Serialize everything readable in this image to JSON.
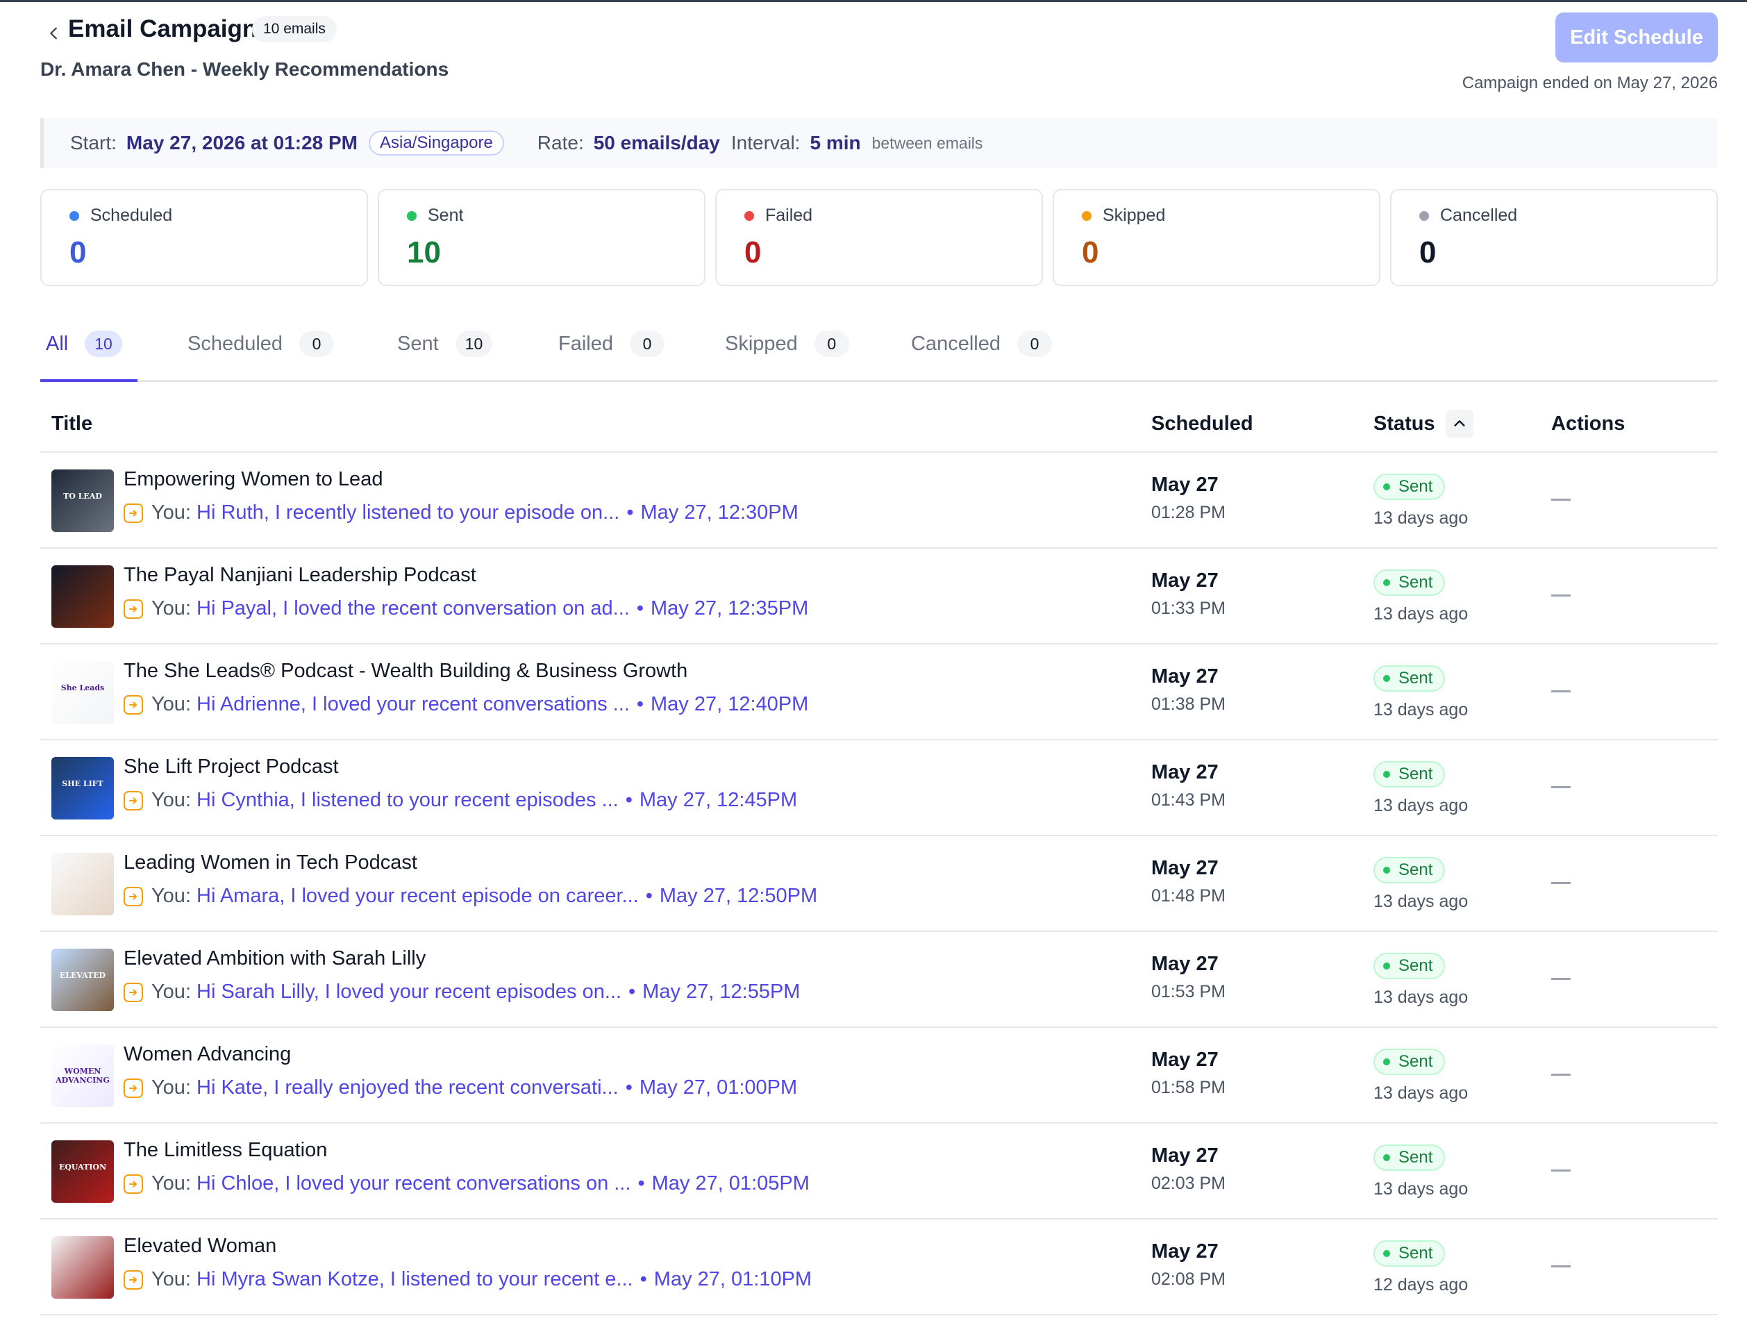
{
  "header": {
    "title": "Email Campaign",
    "count_badge": "10 emails",
    "subtitle": "Dr. Amara Chen - Weekly Recommendations",
    "edit_button": "Edit Schedule",
    "ended_text": "Campaign ended on May 27, 2026"
  },
  "schedule": {
    "start_label": "Start:",
    "start_value": "May 27, 2026 at 01:28 PM",
    "timezone": "Asia/Singapore",
    "rate_label": "Rate:",
    "rate_value": "50 emails/day",
    "interval_label": "Interval:",
    "interval_value": "5 min",
    "interval_suffix": "between emails"
  },
  "stats": [
    {
      "label": "Scheduled",
      "value": "0",
      "color": "#3b5bdb",
      "dot": "#3b82f6"
    },
    {
      "label": "Sent",
      "value": "10",
      "color": "#15803d",
      "dot": "#22c55e"
    },
    {
      "label": "Failed",
      "value": "0",
      "color": "#b91c1c",
      "dot": "#ef4444"
    },
    {
      "label": "Skipped",
      "value": "0",
      "color": "#b45309",
      "dot": "#f59e0b"
    },
    {
      "label": "Cancelled",
      "value": "0",
      "color": "#111827",
      "dot": "#9ca3af"
    }
  ],
  "tabs": [
    {
      "label": "All",
      "count": "10"
    },
    {
      "label": "Scheduled",
      "count": "0"
    },
    {
      "label": "Sent",
      "count": "10"
    },
    {
      "label": "Failed",
      "count": "0"
    },
    {
      "label": "Skipped",
      "count": "0"
    },
    {
      "label": "Cancelled",
      "count": "0"
    }
  ],
  "table": {
    "headers": {
      "title": "Title",
      "scheduled": "Scheduled",
      "status": "Status",
      "actions": "Actions"
    },
    "rows": [
      {
        "title": "Empowering Women to Lead",
        "you": "You:",
        "preview": "Hi Ruth, I recently listened to your episode on...",
        "sep": "•",
        "msg_time": "May 27, 12:30PM",
        "date": "May 27",
        "time": "01:28 PM",
        "status": "Sent",
        "ago": "13 days ago",
        "thumb_colors": [
          "#1f2937",
          "#6b7280"
        ],
        "thumb_text": "TO LEAD"
      },
      {
        "title": "The Payal Nanjiani Leadership Podcast",
        "you": "You:",
        "preview": "Hi Payal, I loved the recent conversation on ad...",
        "sep": "•",
        "msg_time": "May 27, 12:35PM",
        "date": "May 27",
        "time": "01:33 PM",
        "status": "Sent",
        "ago": "13 days ago",
        "thumb_colors": [
          "#111827",
          "#7c2d12"
        ],
        "thumb_text": ""
      },
      {
        "title": "The She Leads® Podcast - Wealth Building & Business Growth",
        "you": "You:",
        "preview": "Hi Adrienne, I loved your recent conversations ...",
        "sep": "•",
        "msg_time": "May 27, 12:40PM",
        "date": "May 27",
        "time": "01:38 PM",
        "status": "Sent",
        "ago": "13 days ago",
        "thumb_colors": [
          "#ffffff",
          "#f3f4f6"
        ],
        "thumb_text": "She Leads"
      },
      {
        "title": "She Lift Project Podcast",
        "you": "You:",
        "preview": "Hi Cynthia, I listened to your recent episodes ...",
        "sep": "•",
        "msg_time": "May 27, 12:45PM",
        "date": "May 27",
        "time": "01:43 PM",
        "status": "Sent",
        "ago": "13 days ago",
        "thumb_colors": [
          "#1e3a5f",
          "#2563eb"
        ],
        "thumb_text": "SHE LIFT"
      },
      {
        "title": "Leading Women in Tech Podcast",
        "you": "You:",
        "preview": "Hi Amara, I loved your recent episode on career...",
        "sep": "•",
        "msg_time": "May 27, 12:50PM",
        "date": "May 27",
        "time": "01:48 PM",
        "status": "Sent",
        "ago": "13 days ago",
        "thumb_colors": [
          "#f9fafb",
          "#e5d5c5"
        ],
        "thumb_text": ""
      },
      {
        "title": "Elevated Ambition with Sarah Lilly",
        "you": "You:",
        "preview": "Hi Sarah Lilly, I loved your recent episodes on...",
        "sep": "•",
        "msg_time": "May 27, 12:55PM",
        "date": "May 27",
        "time": "01:53 PM",
        "status": "Sent",
        "ago": "13 days ago",
        "thumb_colors": [
          "#bfdbfe",
          "#7c5a3a"
        ],
        "thumb_text": "ELEVATED"
      },
      {
        "title": "Women Advancing",
        "you": "You:",
        "preview": "Hi Kate, I really enjoyed the recent conversati...",
        "sep": "•",
        "msg_time": "May 27, 01:00PM",
        "date": "May 27",
        "time": "01:58 PM",
        "status": "Sent",
        "ago": "13 days ago",
        "thumb_colors": [
          "#ffffff",
          "#ede9fe"
        ],
        "thumb_text": "WOMEN ADVANCING"
      },
      {
        "title": "The Limitless Equation",
        "you": "You:",
        "preview": "Hi Chloe, I loved your recent conversations on ...",
        "sep": "•",
        "msg_time": "May 27, 01:05PM",
        "date": "May 27",
        "time": "02:03 PM",
        "status": "Sent",
        "ago": "13 days ago",
        "thumb_colors": [
          "#3f1d1d",
          "#b91c1c"
        ],
        "thumb_text": "EQUATION"
      },
      {
        "title": "Elevated Woman",
        "you": "You:",
        "preview": "Hi Myra Swan Kotze, I listened to your recent e...",
        "sep": "•",
        "msg_time": "May 27, 01:10PM",
        "date": "May 27",
        "time": "02:08 PM",
        "status": "Sent",
        "ago": "12 days ago",
        "thumb_colors": [
          "#f3f4f6",
          "#991b1b"
        ],
        "thumb_text": ""
      }
    ]
  }
}
